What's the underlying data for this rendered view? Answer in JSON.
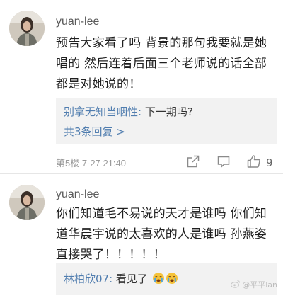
{
  "comments": [
    {
      "username": "yuan-lee",
      "text": "预告大家看了吗 背景的那句我要就是她唱的 然后连着后面三个老师说的话全部都是对她说的！",
      "reply": {
        "user": "别拿无知当咽性",
        "sep": ": ",
        "text": "下一期吗?"
      },
      "more_replies": "共3条回复 >",
      "meta": "第5楼  7-27 21:40",
      "likes": "9"
    },
    {
      "username": "yuan-lee",
      "text": "你们知道毛不易说的天才是谁吗 你们知道华晨宇说的太喜欢的人是谁吗 孙燕姿直接哭了！！！！！",
      "reply": {
        "user": "林柏欣07",
        "sep": ": ",
        "text": "看见了"
      },
      "reply_emojis": [
        "crying-face",
        "crying-face"
      ]
    }
  ],
  "watermark": "@平平lan",
  "icons": [
    "share-icon",
    "comment-icon",
    "like-icon",
    "weibo-logo-icon"
  ],
  "colors": {
    "link": "#507daf",
    "meta": "#9a9a9a",
    "reply_bg": "#f2f2f2"
  }
}
